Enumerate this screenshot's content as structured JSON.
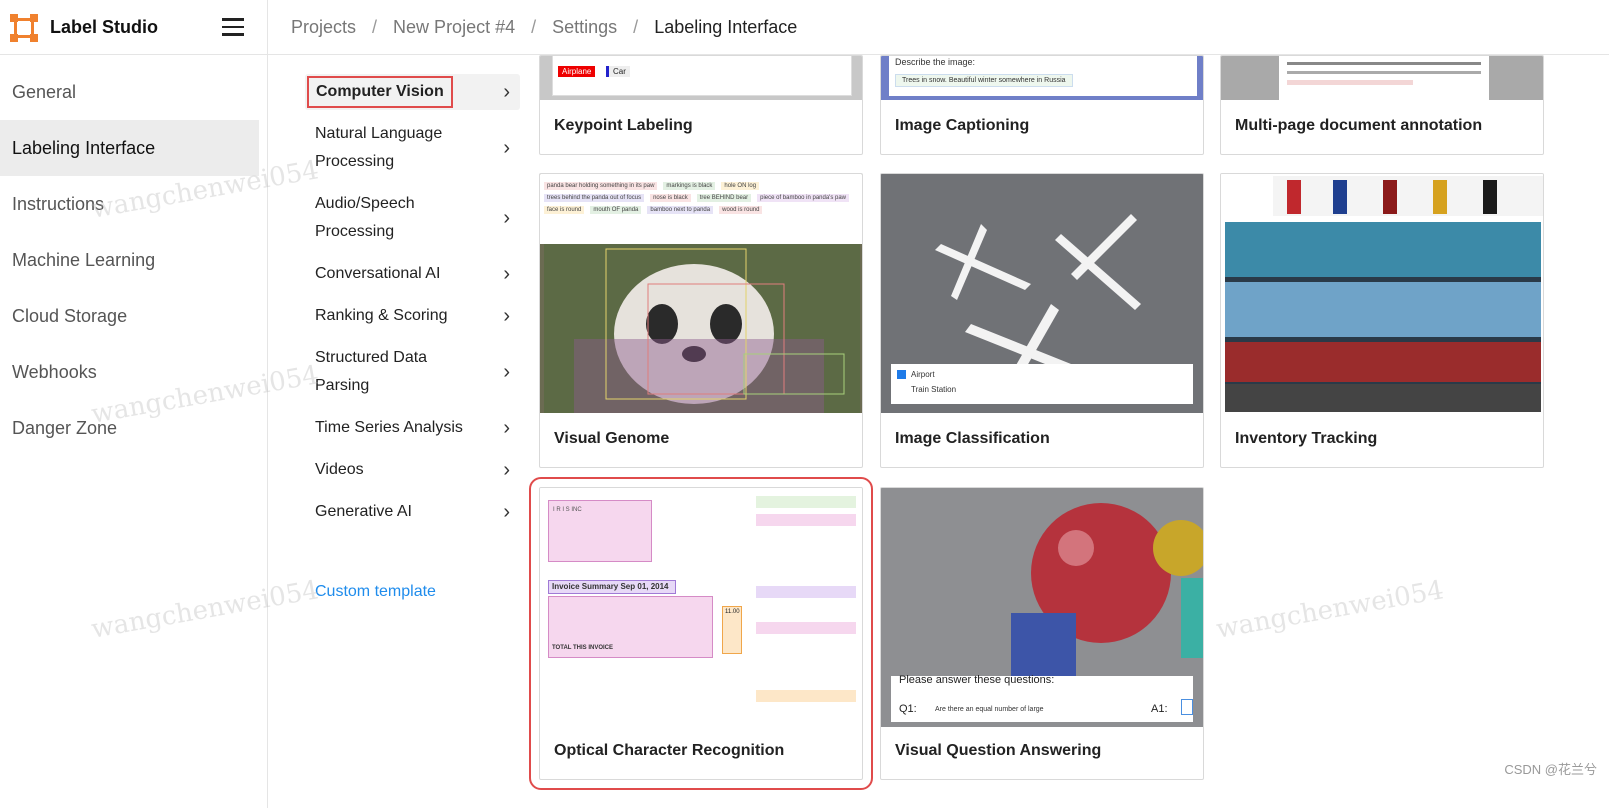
{
  "app": {
    "name": "Label Studio"
  },
  "breadcrumbs": [
    "Projects",
    "New Project #4",
    "Settings",
    "Labeling Interface"
  ],
  "left_nav": [
    "General",
    "Labeling Interface",
    "Instructions",
    "Machine Learning",
    "Cloud Storage",
    "Webhooks",
    "Danger Zone"
  ],
  "left_nav_active": "Labeling Interface",
  "categories": [
    {
      "label": "Computer Vision",
      "active": true
    },
    {
      "label": "Natural Language Processing"
    },
    {
      "label": "Audio/Speech Processing"
    },
    {
      "label": "Conversational AI"
    },
    {
      "label": "Ranking & Scoring"
    },
    {
      "label": "Structured Data Parsing"
    },
    {
      "label": "Time Series Analysis"
    },
    {
      "label": "Videos"
    },
    {
      "label": "Generative AI"
    }
  ],
  "custom_template": "Custom template",
  "templates": [
    {
      "title": "Keypoint Labeling"
    },
    {
      "title": "Image Captioning"
    },
    {
      "title": "Multi-page document annotation"
    },
    {
      "title": "Visual Genome"
    },
    {
      "title": "Image Classification"
    },
    {
      "title": "Inventory Tracking"
    },
    {
      "title": "Optical Character Recognition",
      "highlighted": true
    },
    {
      "title": "Visual Question Answering"
    }
  ],
  "thumbs": {
    "keypoint_tags": [
      "Airplane",
      "Car"
    ],
    "captioning": {
      "prompt": "Describe the image:",
      "text": "Trees in snow. Beautiful winter somewhere in Russia"
    },
    "genome_tags": [
      "panda bear holding something in its paw",
      "markings is black",
      "hole ON log",
      "trees behind the panda out of focus",
      "nose is black",
      "tree BEHIND bear",
      "piece of bamboo in panda's paw",
      "face is round",
      "mouth OF panda",
      "bamboo next to panda",
      "wood is round"
    ],
    "classification_options": [
      "Airport",
      "Train Station"
    ],
    "ocr": {
      "company": "I R I S INC",
      "summary": "Invoice Summary Sep 01, 2014",
      "total": "TOTAL THIS INVOICE",
      "price": "11.00"
    },
    "vqa": {
      "prompt": "Please answer these questions:",
      "q1": "Q1:",
      "question": "Are there an equal number of large",
      "a1": "A1:"
    }
  },
  "watermark": "wangchenwei054",
  "footer": "CSDN @花兰兮",
  "colors": {
    "accent": "#f0812e",
    "highlight": "#e04b4b",
    "link": "#1f8cec"
  }
}
